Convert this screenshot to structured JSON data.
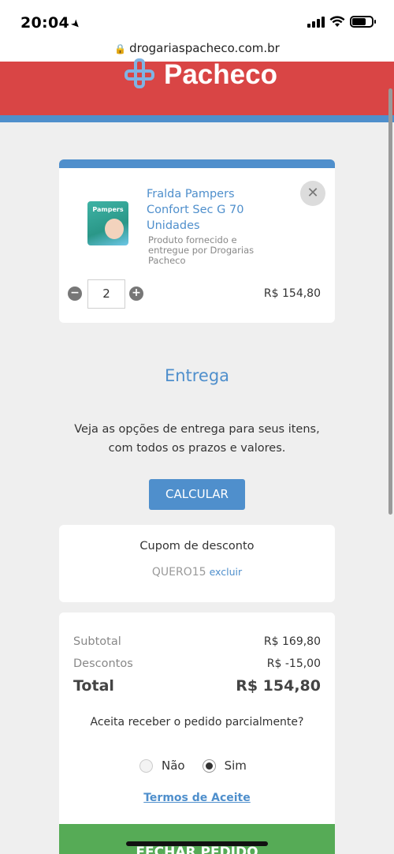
{
  "status_bar": {
    "time": "20:04"
  },
  "browser": {
    "url": "drogariaspacheco.com.br"
  },
  "header": {
    "logo_text": "Pacheco"
  },
  "cart_item": {
    "name": "Fralda Pampers Confort Sec G 70 Unidades",
    "seller_note": "Produto fornecido e entregue por Drogarias Pacheco",
    "image_brand": "Pampers",
    "quantity": "2",
    "price": "R$ 154,80"
  },
  "delivery": {
    "title": "Entrega",
    "description_line1": "Veja as opções de entrega para seus itens,",
    "description_line2": "com todos os prazos e valores.",
    "calculate_label": "CALCULAR"
  },
  "coupon": {
    "title": "Cupom de desconto",
    "code": "QUERO15",
    "remove_label": "excluir"
  },
  "summary": {
    "subtotal_label": "Subtotal",
    "subtotal_value": "R$ 169,80",
    "discount_label": "Descontos",
    "discount_value": "R$ -15,00",
    "total_label": "Total",
    "total_value": "R$ 154,80",
    "partial_question": "Aceita receber o pedido parcialmente?",
    "option_no": "Não",
    "option_yes": "Sim",
    "selected_option": "Sim",
    "terms_label": "Termos de Aceite",
    "checkout_label": "FECHAR PEDIDO"
  },
  "colors": {
    "brand_red": "#d94545",
    "brand_blue": "#4f8fcc",
    "checkout_green": "#56ab56"
  }
}
